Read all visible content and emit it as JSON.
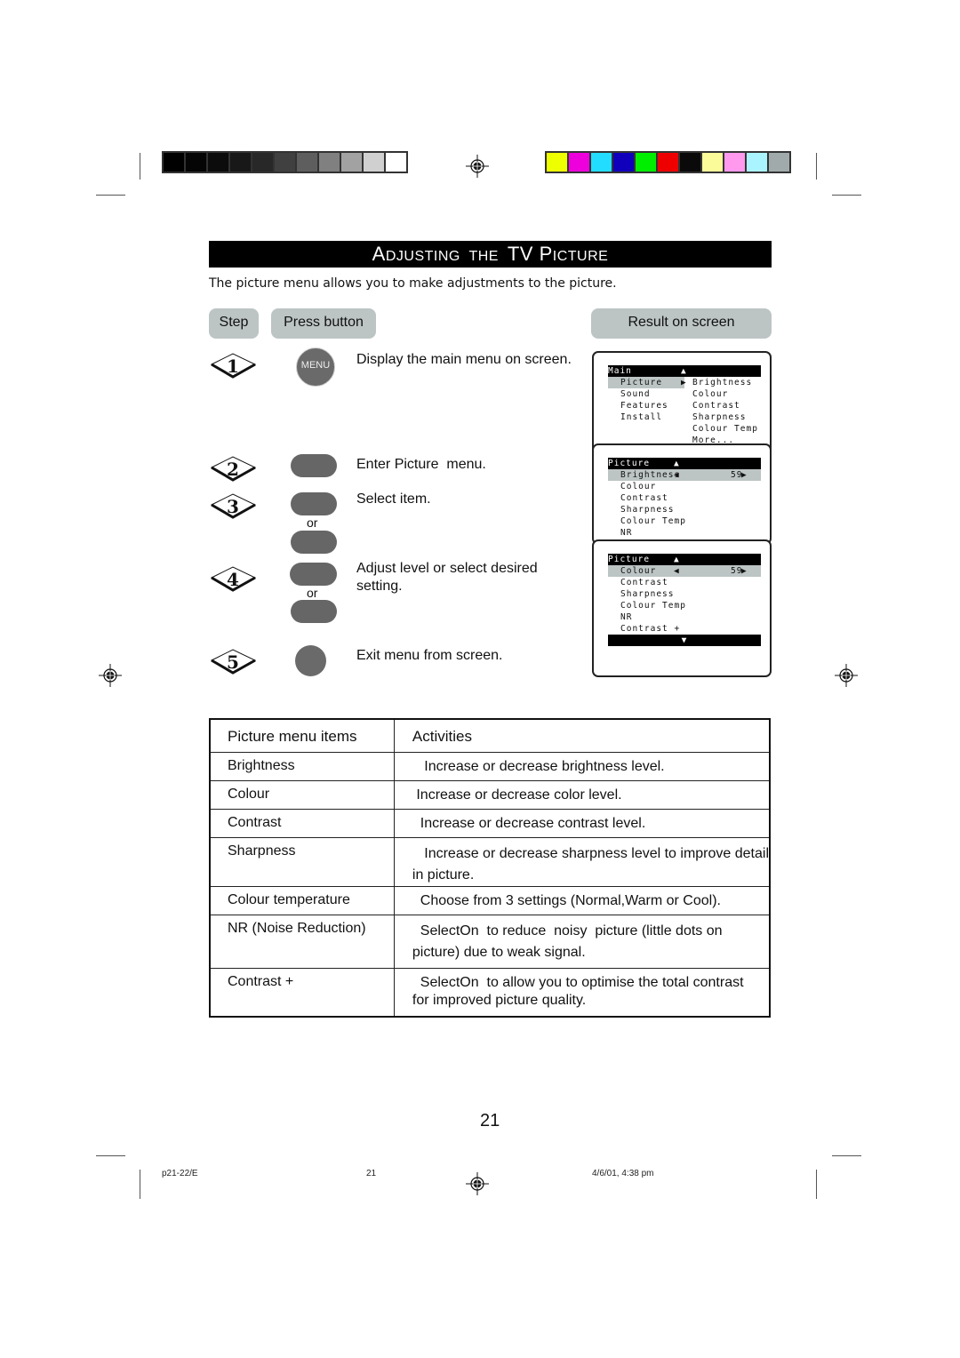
{
  "print_marks": {
    "gray_swatches": [
      "#000000",
      "#050505",
      "#0c0c0c",
      "#181818",
      "#282828",
      "#404040",
      "#5e5e5e",
      "#808080",
      "#a2a2a2",
      "#d0d0d0",
      "#ffffff"
    ],
    "color_swatches": [
      "#eeff00",
      "#ee00dd",
      "#22ddff",
      "#1100bb",
      "#00ee00",
      "#ee0000",
      "#0a0a0a",
      "#fbfb99",
      "#ff99ee",
      "#aaf4ff",
      "#a0aaaa"
    ]
  },
  "header": {
    "title_parts": [
      {
        "text": "A",
        "big": true
      },
      {
        "text": "DJUSTING  THE  ",
        "big": false
      },
      {
        "text": "TV P",
        "big": true
      },
      {
        "text": "ICTURE",
        "big": false
      }
    ],
    "intro": "The picture menu allows you to make adjustments to the picture."
  },
  "columns": {
    "step": "Step",
    "press_button": "Press button",
    "result": "Result on screen"
  },
  "steps": [
    {
      "number": "1",
      "button_label": "MENU",
      "text": "Display the main menu on screen."
    },
    {
      "number": "2",
      "button_label": "",
      "text": "Enter Picture  menu."
    },
    {
      "number": "3",
      "button_label": "",
      "or": "or",
      "text": "Select item."
    },
    {
      "number": "4",
      "button_label": "",
      "or": "or",
      "text": "Adjust level or select desired setting."
    },
    {
      "number": "5",
      "button_label": "",
      "text": "Exit menu from screen."
    }
  ],
  "osd_screens": [
    {
      "header": "Main",
      "header_arrow": "▲",
      "rows": [
        {
          "left": "Picture",
          "mid": "▶",
          "right": "Brightness",
          "selected": true
        },
        {
          "left": "Sound",
          "right": "Colour"
        },
        {
          "left": "Features",
          "right": "Contrast"
        },
        {
          "left": "Install",
          "right": "Sharpness"
        },
        {
          "left": "",
          "right": "Colour Temp"
        },
        {
          "left": "",
          "right": "More..."
        }
      ]
    },
    {
      "header": "Picture",
      "header_arrow": "▲",
      "rows": [
        {
          "label": "Brightness",
          "left_arrow": "◀",
          "value": "59",
          "right_arrow": "▶",
          "selected": true
        },
        {
          "label": "Colour"
        },
        {
          "label": "Contrast"
        },
        {
          "label": "Sharpness"
        },
        {
          "label": "Colour Temp"
        },
        {
          "label": "NR"
        }
      ]
    },
    {
      "header": "Picture",
      "header_arrow": "▲",
      "footer_arrow": "▼",
      "rows": [
        {
          "label": "Colour",
          "left_arrow": "◀",
          "value": "59",
          "right_arrow": "▶",
          "selected": true
        },
        {
          "label": "Contrast"
        },
        {
          "label": "Sharpness"
        },
        {
          "label": "Colour Temp"
        },
        {
          "label": "NR"
        },
        {
          "label": "Contrast +"
        }
      ]
    }
  ],
  "table": {
    "headers": [
      "Picture menu items",
      "Activities"
    ],
    "rows": [
      {
        "item": "Brightness",
        "activity": [
          "   Increase or decrease brightness level."
        ]
      },
      {
        "item": "Colour",
        "activity": [
          " Increase or decrease color level."
        ]
      },
      {
        "item": "Contrast",
        "activity": [
          "  Increase or decrease contrast level."
        ]
      },
      {
        "item": "Sharpness",
        "activity": [
          "   Increase or decrease sharpness level to improve detail",
          "in picture."
        ]
      },
      {
        "item": "Colour temperature",
        "activity": [
          "  Choose from 3 settings (Normal,Warm or Cool)."
        ]
      },
      {
        "item": "NR (Noise Reduction)",
        "activity": [
          "  SelectOn  to reduce  noisy  picture (little dots on",
          "picture) due to weak signal."
        ]
      },
      {
        "item": "Contrast +",
        "activity": [
          "  SelectOn  to allow you to optimise the total contrast",
          "for improved picture quality."
        ]
      }
    ]
  },
  "page_number": "21",
  "footer": {
    "file": "p21-22/E",
    "page": "21",
    "datetime": "4/6/01, 4:38 pm"
  }
}
